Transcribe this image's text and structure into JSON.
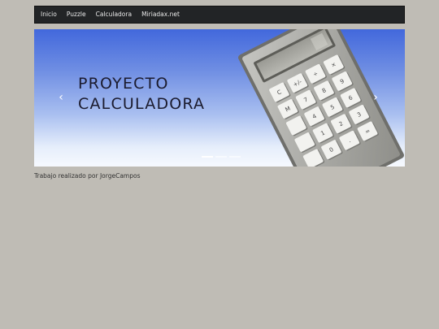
{
  "nav": {
    "items": [
      "Inicio",
      "Puzzle",
      "Calculadora",
      "Miriadax.net"
    ]
  },
  "carousel": {
    "headline_line1": "PROYECTO",
    "headline_line2": "CALCULADORA",
    "prev_icon": "‹",
    "next_icon": "›",
    "icons": {
      "prev": "chevron-left-icon",
      "next": "chevron-right-icon"
    }
  },
  "calculator": {
    "keys": [
      "C",
      "+/-",
      "÷",
      "×",
      "M",
      "7",
      "8",
      "9",
      "",
      "4",
      "5",
      "6",
      "",
      "1",
      "2",
      "3",
      "",
      "0",
      ".",
      "="
    ]
  },
  "footer": {
    "text": "Trabajo realizado por JorgeCampos"
  },
  "colors": {
    "page_background": "#bfbcb5",
    "navbar": "#222426",
    "nav_text": "#e9e9e9",
    "banner_top": "#4268dc",
    "banner_bottom": "#f6f9fe"
  }
}
